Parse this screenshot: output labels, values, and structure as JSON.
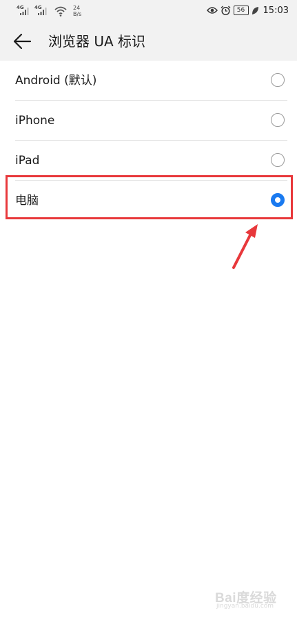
{
  "status_bar": {
    "network_1": "4G",
    "network_2": "4G",
    "speed_value": "24",
    "speed_unit": "B/s",
    "battery": "56",
    "time": "15:03"
  },
  "header": {
    "title": "浏览器 UA 标识"
  },
  "options": [
    {
      "label": "Android (默认)",
      "selected": false
    },
    {
      "label": "iPhone",
      "selected": false
    },
    {
      "label": "iPad",
      "selected": false
    },
    {
      "label": "电脑",
      "selected": true
    }
  ],
  "colors": {
    "accent": "#1a7af0",
    "annotation": "#e8383b",
    "header_bg": "#f2f2f2"
  },
  "watermark": {
    "text": "Bai度经验",
    "sub": "jingyan.baidu.com"
  }
}
